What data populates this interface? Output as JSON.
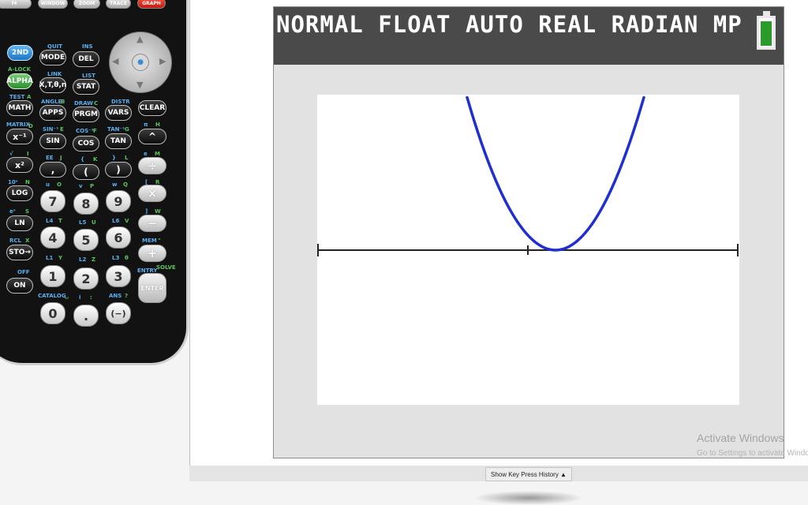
{
  "keypad": {
    "top_keys": [
      {
        "label": "f4",
        "red": false
      },
      {
        "label": "WINDOW",
        "red": false
      },
      {
        "label": "ZOOM",
        "red": false
      },
      {
        "label": "TRACE",
        "red": false
      },
      {
        "label": "GRAPH",
        "red": true
      }
    ],
    "keys": {
      "second": "2ND",
      "mode": "MODE",
      "del": "DEL",
      "alpha": "ALPHA",
      "xvar": "X,T,θ,n",
      "stat": "STAT",
      "math": "MATH",
      "apps": "APPS",
      "prgm": "PRGM",
      "vars": "VARS",
      "clear": "CLEAR",
      "inverse": "x⁻¹",
      "sin": "SIN",
      "cos": "COS",
      "tan": "TAN",
      "power": "^",
      "square": "x²",
      "comma": ",",
      "lparen": "(",
      "rparen": ")",
      "divide": "÷",
      "log": "LOG",
      "seven": "7",
      "eight": "8",
      "nine": "9",
      "multiply": "×",
      "ln": "LN",
      "four": "4",
      "five": "5",
      "six": "6",
      "minus": "−",
      "sto": "STO→",
      "one": "1",
      "two": "2",
      "three": "3",
      "plus": "+",
      "on": "ON",
      "zero": "0",
      "decimal": ".",
      "negative": "(−)",
      "enter": "ENTER"
    },
    "secondary": {
      "quit": "QUIT",
      "ins": "INS",
      "a_lock": "A-LOCK",
      "link": "LINK",
      "list": "LIST",
      "test": "TEST",
      "test_a": "A",
      "angle": "ANGLE",
      "angle_b": "B",
      "draw": "DRAW",
      "draw_c": "C",
      "distr": "DISTR",
      "matrix": "MATRIX",
      "matrix_d": "D",
      "sin_inv": "SIN⁻¹",
      "sin_inv_e": "E",
      "cos_inv": "COS⁻¹",
      "cos_inv_f": "F",
      "tan_inv": "TAN⁻¹",
      "tan_inv_g": "G",
      "pi": "π",
      "pi_h": "H",
      "sqrt": "√",
      "sqrt_i": "I",
      "ee": "EE",
      "ee_j": "J",
      "lbrace": "{",
      "lbrace_k": "K",
      "rbrace": "}",
      "rbrace_l": "L",
      "e_key": "e",
      "e_m": "M",
      "tenx": "10ˣ",
      "tenx_n": "N",
      "u": "u",
      "u_o": "O",
      "v": "v",
      "v_p": "P",
      "w": "w",
      "w_q": "Q",
      "lbracket": "[",
      "lbracket_r": "R",
      "ex": "eˣ",
      "ex_s": "S",
      "l4": "L4",
      "l4_t": "T",
      "l5": "L5",
      "l5_u": "U",
      "l6": "L6",
      "l6_v": "V",
      "rbracket": "]",
      "rbracket_w": "W",
      "rcl": "RCL",
      "rcl_x": "X",
      "l1": "L1",
      "l1_y": "Y",
      "l2": "L2",
      "l2_z": "Z",
      "l3": "L3",
      "l3_theta": "θ",
      "mem": "MEM",
      "mem_quote": "\"",
      "off": "OFF",
      "catalog": "CATALOG",
      "catalog_space": "␣",
      "i": "i",
      "i_colon": ":",
      "ans": "ANS",
      "ans_q": "?",
      "entry": "ENTRY",
      "solve": "SOLVE"
    }
  },
  "screen": {
    "mode_line": "NORMAL FLOAT AUTO REAL RADIAN MP",
    "battery_color": "#2a9a2a",
    "curve_color": "#1f2fd0"
  },
  "footer": {
    "history_button": "Show Key Press History ▲"
  },
  "watermark": {
    "title": "Activate Windows",
    "subtitle": "Go to Settings to activate Windows."
  }
}
